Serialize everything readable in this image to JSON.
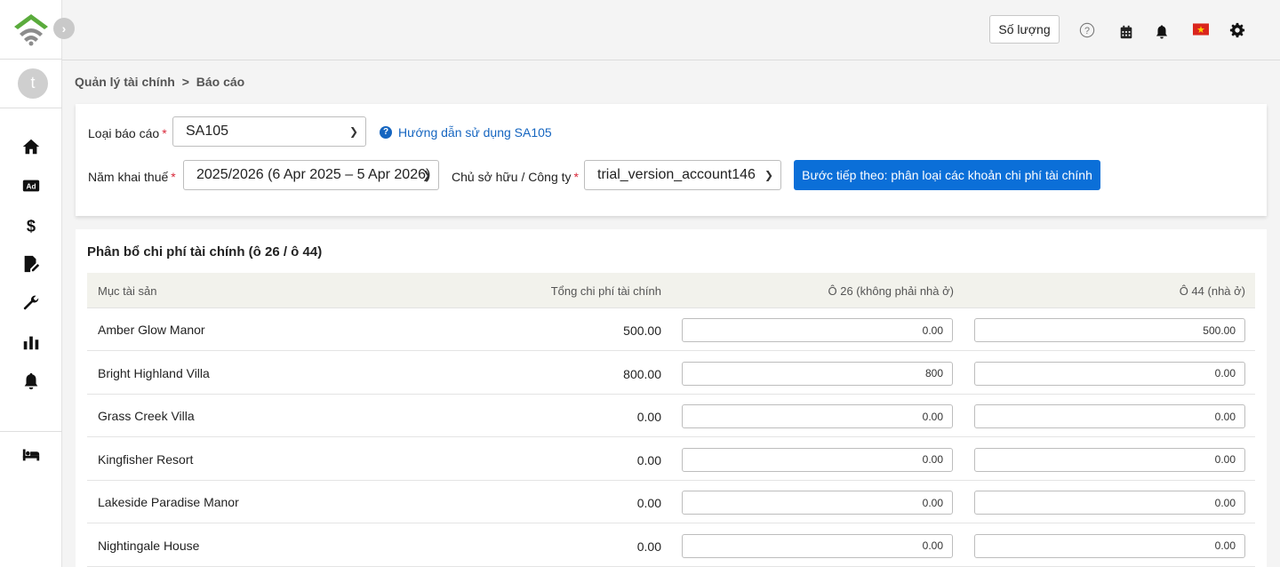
{
  "topbar": {
    "qty_label": "Số lượng",
    "flag_color": "#da251d"
  },
  "sidebar": {
    "avatar_letter": "t",
    "items": [
      "home-icon",
      "ad-icon",
      "dollar-icon",
      "file-signature-icon",
      "wrench-icon",
      "chart-bar-icon",
      "bell-icon",
      "bed-icon"
    ]
  },
  "breadcrumb": {
    "parent": "Quản lý tài chính",
    "separator": ">",
    "current": "Báo cáo"
  },
  "filters": {
    "report_type_label": "Loại báo cáo",
    "report_type_value": "SA105",
    "help_link": "Hướng dẫn sử dụng SA105",
    "tax_year_label": "Năm khai thuế",
    "tax_year_value": "2025/2026 (6 Apr 2025 – 5 Apr 2026)",
    "owner_label": "Chủ sở hữu / Công ty",
    "owner_value": "trial_version_account146",
    "next_button": "Bước tiếp theo: phân loại các khoản chi phí tài chính",
    "required_mark": "*"
  },
  "table": {
    "title": "Phân bổ chi phí tài chính (ô 26 / ô 44)",
    "columns": [
      "Mục tài sản",
      "Tổng chi phí tài chính",
      "Ô 26 (không phải nhà ở)",
      "Ô 44 (nhà ở)"
    ],
    "rows": [
      {
        "name": "Amber Glow Manor",
        "total": "500.00",
        "box26": "0.00",
        "box44": "500.00"
      },
      {
        "name": "Bright Highland Villa",
        "total": "800.00",
        "box26": "800",
        "box44": "0.00"
      },
      {
        "name": "Grass Creek Villa",
        "total": "0.00",
        "box26": "0.00",
        "box44": "0.00"
      },
      {
        "name": "Kingfisher Resort",
        "total": "0.00",
        "box26": "0.00",
        "box44": "0.00"
      },
      {
        "name": "Lakeside Paradise Manor",
        "total": "0.00",
        "box26": "0.00",
        "box44": "0.00"
      },
      {
        "name": "Nightingale House",
        "total": "0.00",
        "box26": "0.00",
        "box44": "0.00"
      }
    ]
  },
  "colors": {
    "accent": "#0b6fd8",
    "link": "#1565c0",
    "logo_green": "#5aab3c",
    "logo_gray": "#8c8c8c"
  }
}
